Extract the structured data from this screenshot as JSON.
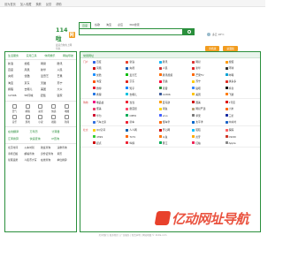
{
  "topbar": {
    "links": [
      "设为首页",
      "加入收藏",
      "换肤",
      "反馈",
      "帮助"
    ]
  },
  "logo": {
    "name": "114啦",
    "badge": "网",
    "slogan": "最适合你的上网导航"
  },
  "search": {
    "tabs": [
      "百度",
      "谷歌",
      "淘宝",
      "必应",
      "360搜索"
    ],
    "active": 0
  },
  "weather": {
    "text": "多云 18°C"
  },
  "right_buttons": [
    "手机版",
    "桌面版"
  ],
  "left_panel": {
    "cat_tabs": [
      "生活服务",
      "实用工具",
      "休闲娱乐",
      "网站导航"
    ],
    "sites": [
      "新浪",
      "搜狐",
      "网易",
      "腾讯",
      "百度",
      "凤凰",
      "新华",
      "人民",
      "央视",
      "优酷",
      "爱奇艺",
      "芒果",
      "淘宝",
      "京东",
      "天猫",
      "苏宁",
      "携程",
      "去哪儿",
      "美团",
      "大众",
      "12306",
      "58同城",
      "赶集",
      "链家"
    ],
    "icons": [
      "天气",
      "邮箱",
      "彩票",
      "快递",
      "地图",
      "音乐",
      "游戏",
      "小说",
      "视频",
      "新闻"
    ],
    "tools": [
      "在线翻译",
      "万年历",
      "计算器",
      "汇率换算",
      "快递查询",
      "IP查询"
    ],
    "links": [
      "北京时间",
      "火车时刻",
      "航班查询",
      "违章查询",
      "手机归属",
      "邮编查询",
      "身份证查询",
      "黄历",
      "星座运势",
      "人民币大写",
      "在线查询",
      "单位换算"
    ]
  },
  "main_panel": {
    "head": "常用网址",
    "sections": [
      {
        "label": "门户",
        "items": [
          {
            "name": "百度",
            "color": "#2e64e6"
          },
          {
            "name": "新浪",
            "color": "#e8412c"
          },
          {
            "name": "腾讯",
            "color": "#12b7f5"
          },
          {
            "name": "网易",
            "color": "#d33"
          },
          {
            "name": "搜狐",
            "color": "#f90"
          },
          {
            "name": "凤凰",
            "color": "#c00"
          },
          {
            "name": "央视",
            "color": "#1a5db5"
          },
          {
            "name": "人民",
            "color": "#c33"
          },
          {
            "name": "新华",
            "color": "#d22"
          },
          {
            "name": "环球",
            "color": "#333"
          },
          {
            "name": "优酷",
            "color": "#1e90ff"
          },
          {
            "name": "爱奇艺",
            "color": "#0b0"
          },
          {
            "name": "腾讯视频",
            "color": "#ff6a00"
          },
          {
            "name": "芒果TV",
            "color": "#f60"
          },
          {
            "name": "哔哩",
            "color": "#00a1d6"
          },
          {
            "name": "淘宝",
            "color": "#ff5000"
          },
          {
            "name": "京东",
            "color": "#e1251b"
          },
          {
            "name": "天猫",
            "color": "#ff0036"
          },
          {
            "name": "苏宁",
            "color": "#fc0"
          },
          {
            "name": "拼多多",
            "color": "#e02e24"
          },
          {
            "name": "微博",
            "color": "#e6162d"
          },
          {
            "name": "知乎",
            "color": "#0084ff"
          },
          {
            "name": "豆瓣",
            "color": "#2a8f3c"
          },
          {
            "name": "贴吧",
            "color": "#3385ff"
          },
          {
            "name": "抖音",
            "color": "#111"
          },
          {
            "name": "携程",
            "color": "#2577e3"
          },
          {
            "name": "去哪儿",
            "color": "#00c1de"
          },
          {
            "name": "12306",
            "color": "#3b5998"
          },
          {
            "name": "美团",
            "color": "#ffc300"
          },
          {
            "name": "飞猪",
            "color": "#ff7b00"
          }
        ]
      },
      {
        "label": "购物",
        "items": [
          {
            "name": "唯品会",
            "color": "#f10180"
          },
          {
            "name": "当当",
            "color": "#e23"
          },
          {
            "name": "亚马逊",
            "color": "#f90"
          },
          {
            "name": "国美",
            "color": "#c00"
          },
          {
            "name": "1号店",
            "color": "#d00"
          },
          {
            "name": "聚美",
            "color": "#ec3b6c"
          },
          {
            "name": "蘑菇街",
            "color": "#f46"
          },
          {
            "name": "闲鱼",
            "color": "#ffd700"
          },
          {
            "name": "网易严选",
            "color": "#b4a078"
          },
          {
            "name": "小米",
            "color": "#ff6700"
          },
          {
            "name": "华为",
            "color": "#cf0a2c"
          },
          {
            "name": "OPPO",
            "color": "#0a5"
          },
          {
            "name": "vivo",
            "color": "#415fff"
          },
          {
            "name": "苹果",
            "color": "#777"
          },
          {
            "name": "三星",
            "color": "#1428a0"
          },
          {
            "name": "汽车之家",
            "color": "#2f6fdf"
          },
          {
            "name": "易车",
            "color": "#e23"
          },
          {
            "name": "懂车帝",
            "color": "#f60"
          },
          {
            "name": "太平洋",
            "color": "#06c"
          },
          {
            "name": "中关村",
            "color": "#1b64c8"
          }
        ]
      },
      {
        "label": "社交",
        "items": [
          {
            "name": "QQ空间",
            "color": "#fc0"
          },
          {
            "name": "人人网",
            "color": "#005eac"
          },
          {
            "name": "开心网",
            "color": "#c00"
          },
          {
            "name": "陌陌",
            "color": "#00c0ff"
          },
          {
            "name": "探探",
            "color": "#ff5f5f"
          },
          {
            "name": "4399",
            "color": "#3c3"
          },
          {
            "name": "7k7k",
            "color": "#f60"
          },
          {
            "name": "斗鱼",
            "color": "#f70"
          },
          {
            "name": "虎牙",
            "color": "#fa0"
          },
          {
            "name": "CSDN",
            "color": "#c32"
          },
          {
            "name": "起点",
            "color": "#c00"
          },
          {
            "name": "纵横",
            "color": "#e23"
          },
          {
            "name": "晋江",
            "color": "#0a5"
          },
          {
            "name": "红袖",
            "color": "#e25"
          },
          {
            "name": "Apple",
            "color": "#888"
          }
        ]
      }
    ]
  },
  "footer": {
    "text": "关于我们 | 联系我们 | 广告服务 | 免责声明 | 网站地图 © 114la.com"
  },
  "watermark": {
    "text": "亿动网址导航"
  }
}
